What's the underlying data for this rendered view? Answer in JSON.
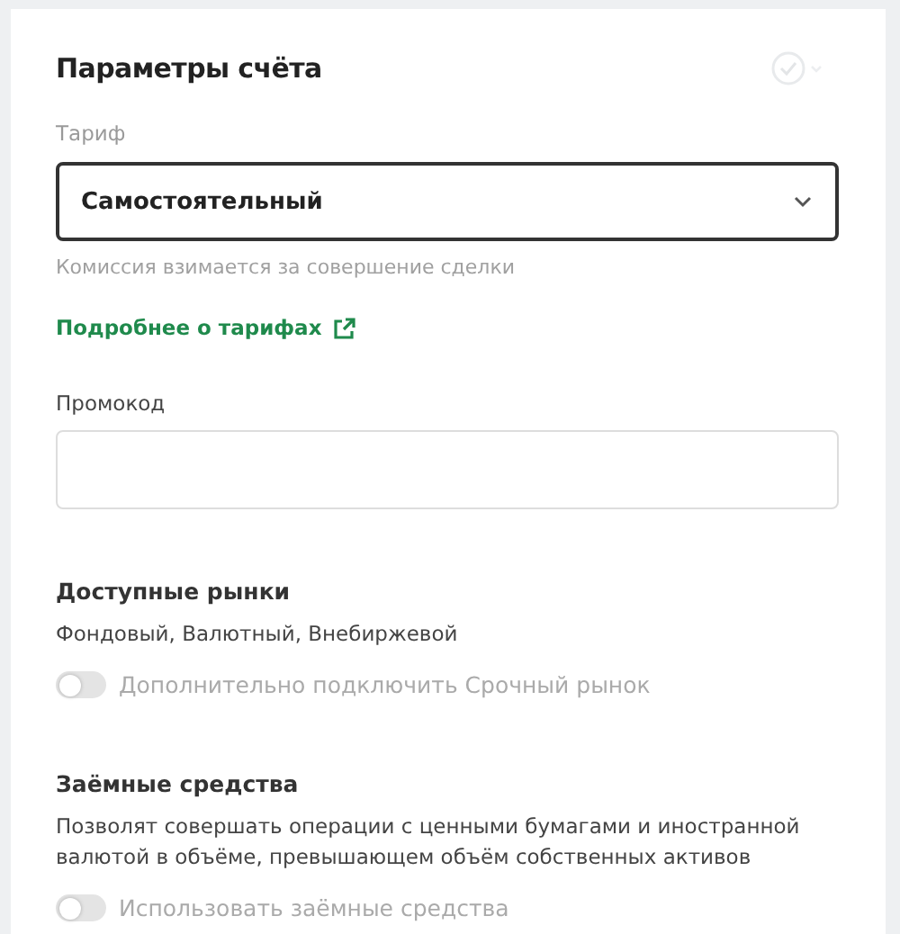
{
  "card": {
    "title": "Параметры счёта",
    "status_icon": {
      "checked": true
    }
  },
  "tariff": {
    "label": "Тариф",
    "value": "Самостоятельный",
    "hint": "Комиссия взимается за совершение сделки",
    "link": "Подробнее о тарифах"
  },
  "promo": {
    "label": "Промокод"
  },
  "sections": [
    {
      "title": "Доступные рынки",
      "text": "Фондовый, Валютный, Внебиржевой",
      "toggle": {
        "label": "Дополнительно подключить Срочный рынок",
        "on": false,
        "disabled": true
      }
    },
    {
      "title": "Заёмные средства",
      "text": "Позволят совершать операции с ценными бумагами и иностранной валютой в объёме, превышающем объём собственных активов",
      "toggle": {
        "label": "Использовать заёмные средства",
        "on": false,
        "disabled": true
      }
    }
  ]
}
